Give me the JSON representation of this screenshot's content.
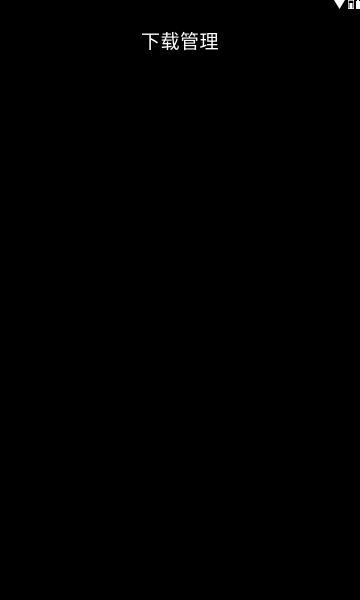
{
  "status_bar": {
    "icons": [
      "wifi-icon",
      "signal-icon",
      "battery-icon"
    ]
  },
  "header": {
    "title": "下载管理"
  },
  "colors": {
    "background": "#000000",
    "text": "#ffffff"
  }
}
